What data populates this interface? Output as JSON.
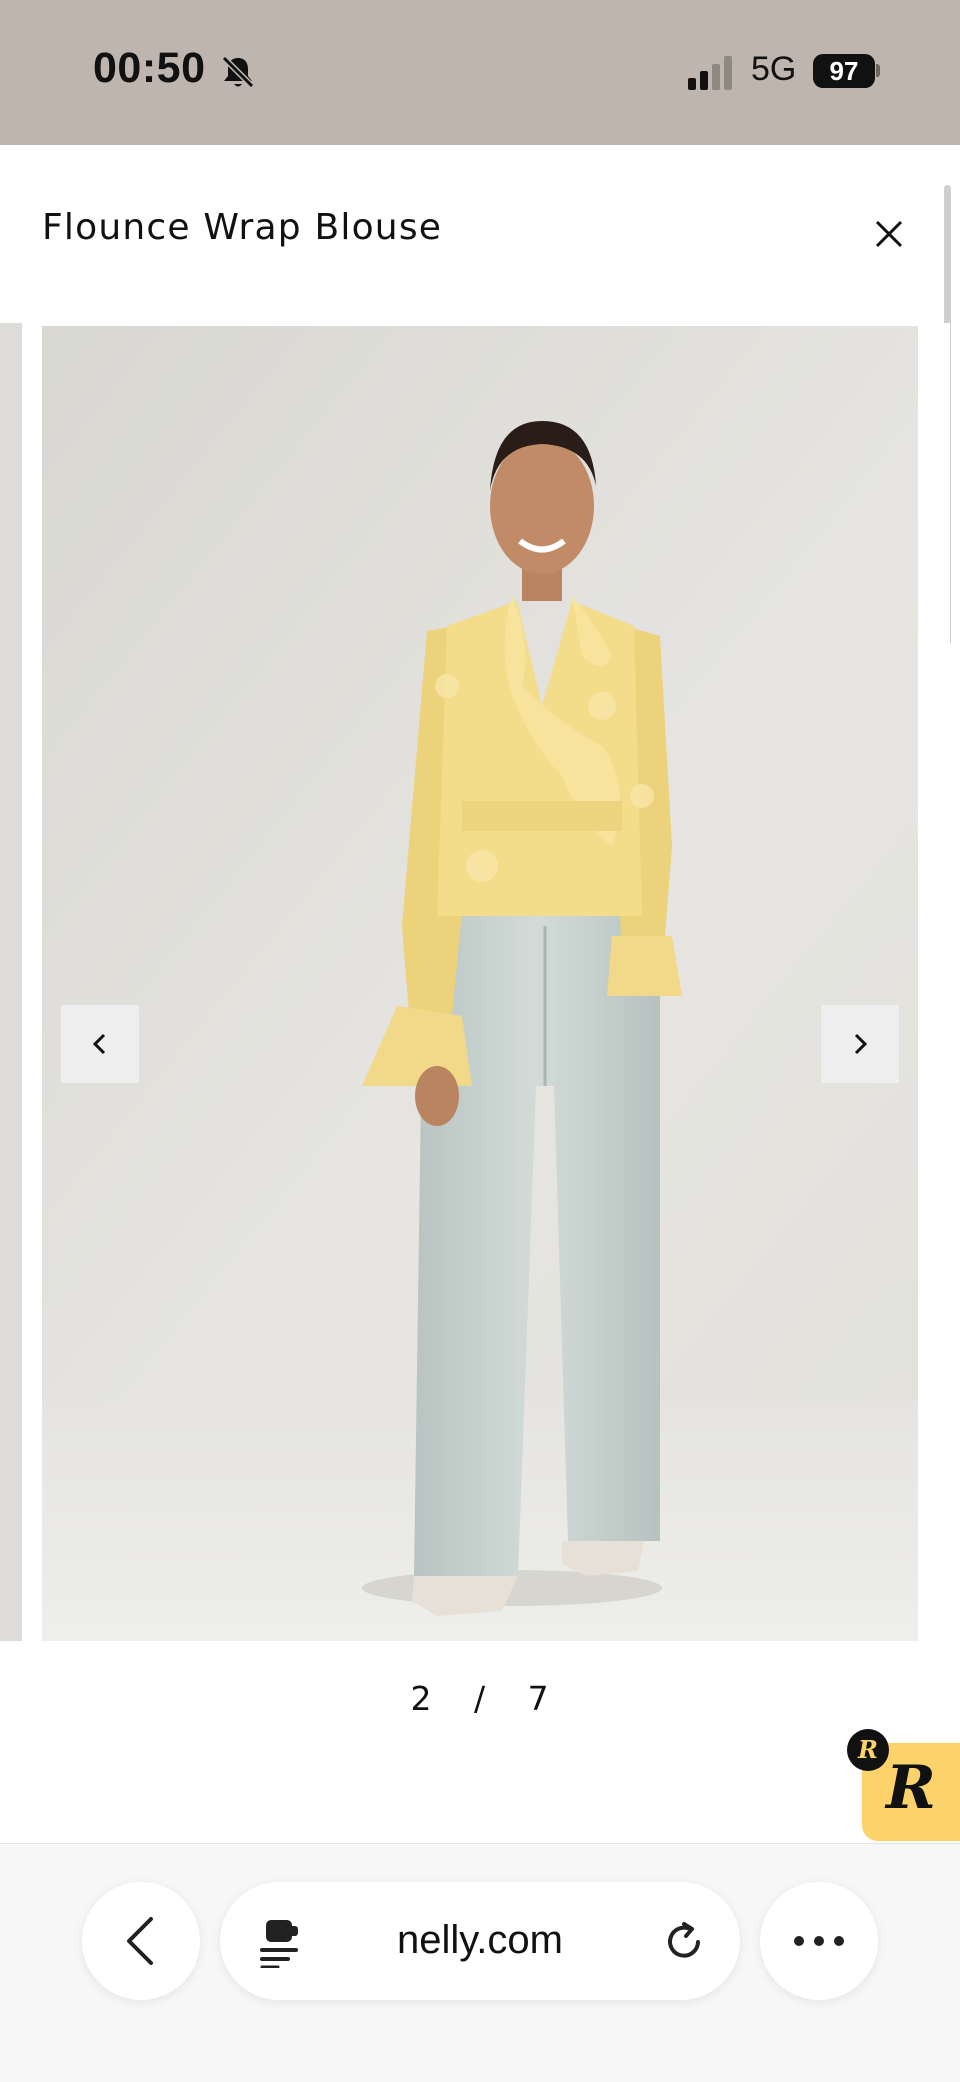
{
  "status_bar": {
    "time": "00:50",
    "network": "5G",
    "battery": "97"
  },
  "product": {
    "title": "Flounce Wrap Blouse"
  },
  "gallery": {
    "current": "2",
    "separator": "/",
    "total": "7"
  },
  "badge": {
    "letter": "R",
    "mini_letter": "R"
  },
  "browser": {
    "url": "nelly.com"
  },
  "icons": {
    "status": [
      "bell-slash-icon",
      "signal-icon",
      "battery-icon"
    ],
    "header": [
      "close-icon"
    ],
    "gallery": [
      "chevron-left-icon",
      "chevron-right-icon"
    ],
    "browser": [
      "back-icon",
      "extension-icon",
      "reload-icon",
      "more-icon"
    ]
  },
  "colors": {
    "status_bar_bg": "#beb6ae",
    "badge_bg": "#fbd36a",
    "blouse": "#f3dc8a",
    "jeans": "#c9d2cf"
  }
}
